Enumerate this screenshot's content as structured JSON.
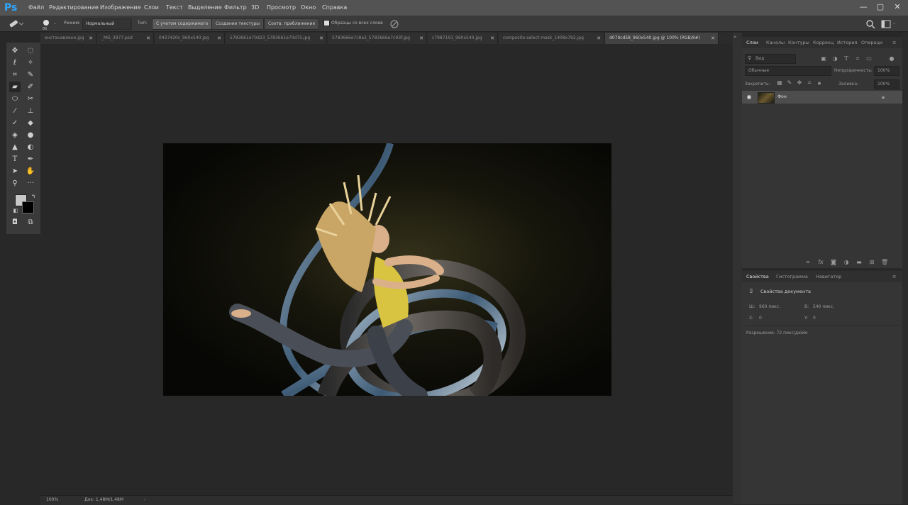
{
  "app": {
    "logo": "Ps"
  },
  "menu": [
    "Файл",
    "Редактирование",
    "Изображение",
    "Слои",
    "Текст",
    "Выделение",
    "Фильтр",
    "3D",
    "Просмотр",
    "Окно",
    "Справка"
  ],
  "window_controls": {
    "minimize": "—",
    "maximize": "▢",
    "close": "✕"
  },
  "options_bar": {
    "mode_label": "Режим:",
    "mode_value": "Нормальный",
    "type_label": "Тип:",
    "type_buttons": [
      "С учетом содержимого",
      "Создание текстуры",
      "Соотв. приближения"
    ],
    "sample_all_label": "Образцы со всех слоев",
    "brush_size": "86"
  },
  "tabs": [
    {
      "label": "енстанавлено.jpg",
      "active": false
    },
    {
      "label": "_MG_3977.psd",
      "active": false
    },
    {
      "label": "0437420c_960x540.jpg",
      "active": false
    },
    {
      "label": "5783661e70d23_5783661e70d75.jpg",
      "active": false
    },
    {
      "label": "5783666e7c8a3_5783666e7c93f.jpg",
      "active": false
    },
    {
      "label": "c7987191_960x540.jpg",
      "active": false
    },
    {
      "label": "composite-select-mask_1408x792.jpg",
      "active": false
    },
    {
      "label": "d079cd58_960x540.jpg @ 100% (RGB/8#)",
      "active": true
    }
  ],
  "status": {
    "zoom": "100%",
    "doc": "Док: 1,48М/1,48М"
  },
  "layers_panel": {
    "tabs": [
      "Слои",
      "Каналы",
      "Контуры",
      "Коррекц",
      "История",
      "Операци"
    ],
    "search_placeholder": "Вид",
    "blend_mode": "Обычные",
    "opacity_label": "Непрозрачность:",
    "opacity_value": "100%",
    "lock_label": "Закрепить:",
    "fill_label": "Заливка:",
    "fill_value": "100%",
    "layer_name": "Фон"
  },
  "properties_panel": {
    "tabs": [
      "Свойства",
      "Гистограмма",
      "Навигатор"
    ],
    "title": "Свойства документа",
    "width_label": "Ш:",
    "width_value": "960 пикс.",
    "height_label": "В:",
    "height_value": "540 пикс.",
    "x_label": "X:",
    "x_value": "0",
    "y_label": "Y:",
    "y_value": "0",
    "resolution": "Разрешение: 72 пикс/дюйм"
  },
  "colors": {
    "accent": "#31a8ff",
    "foreground": "#c8c8c8",
    "background": "#000000"
  }
}
